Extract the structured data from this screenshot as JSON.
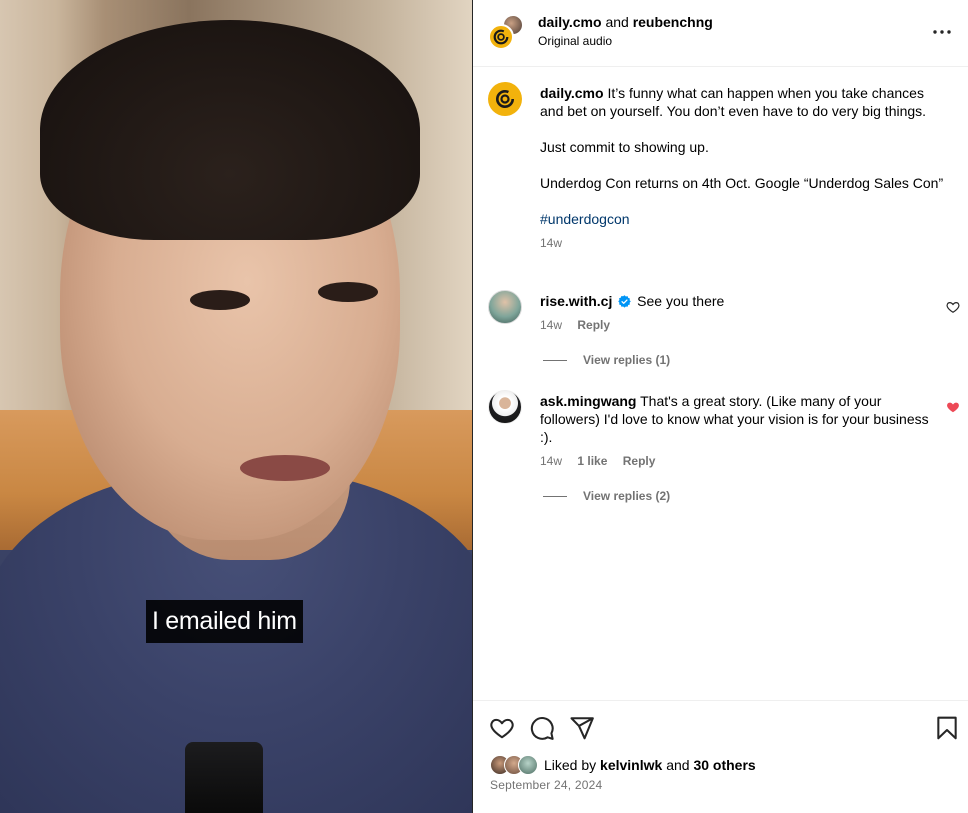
{
  "media": {
    "subtitle": "I emailed him"
  },
  "header": {
    "author": "daily.cmo",
    "connector": "and",
    "collaborator": "reubenchng",
    "audio": "Original audio"
  },
  "caption": {
    "username": "daily.cmo",
    "text_1": "It’s funny what can happen when you take chances and bet on yourself. You don’t even have to do very big things.",
    "text_2": "Just commit to showing up.",
    "text_3": "Underdog Con returns on 4th Oct. Google “Underdog Sales Con”",
    "hashtag": "#underdogcon",
    "time": "14w"
  },
  "comments": [
    {
      "username": "rise.with.cj",
      "verified": true,
      "text": "See you there",
      "time": "14w",
      "reply_label": "Reply",
      "view_replies": "View replies (1)",
      "liked": false
    },
    {
      "username": "ask.mingwang",
      "verified": false,
      "text": "That's a great story. (Like many of your followers) I'd love to know what your vision is for your business :).",
      "time": "14w",
      "likes": "1 like",
      "reply_label": "Reply",
      "view_replies": "View replies (2)",
      "liked": true
    }
  ],
  "footer": {
    "liked_prefix": "Liked by",
    "liked_user": "kelvinlwk",
    "liked_and": "and",
    "liked_others": "30 others",
    "date": "September 24, 2024"
  },
  "icons": {
    "like": "heart-icon",
    "comment": "comment-icon",
    "share": "share-icon",
    "save": "bookmark-icon",
    "more": "more-icon"
  },
  "colors": {
    "brand_logo": "#f2b20c",
    "verified": "#0095f6",
    "like_red": "#ed4956",
    "hashtag": "#00376b",
    "muted": "#737373"
  }
}
